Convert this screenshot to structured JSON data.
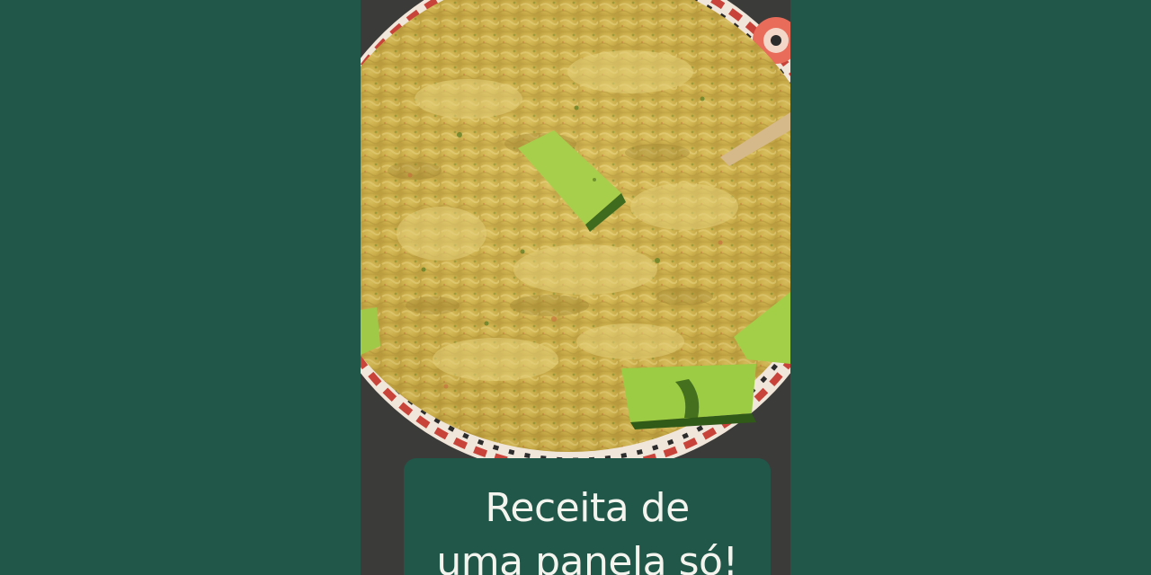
{
  "caption": {
    "line1": "Receita de",
    "line2": "uma panela só!"
  },
  "colors": {
    "background": "#215749",
    "caption_bg": "#215749",
    "caption_text": "#f4f4ee",
    "food": "#d2b54f",
    "zucchini": "#8fc23c"
  }
}
